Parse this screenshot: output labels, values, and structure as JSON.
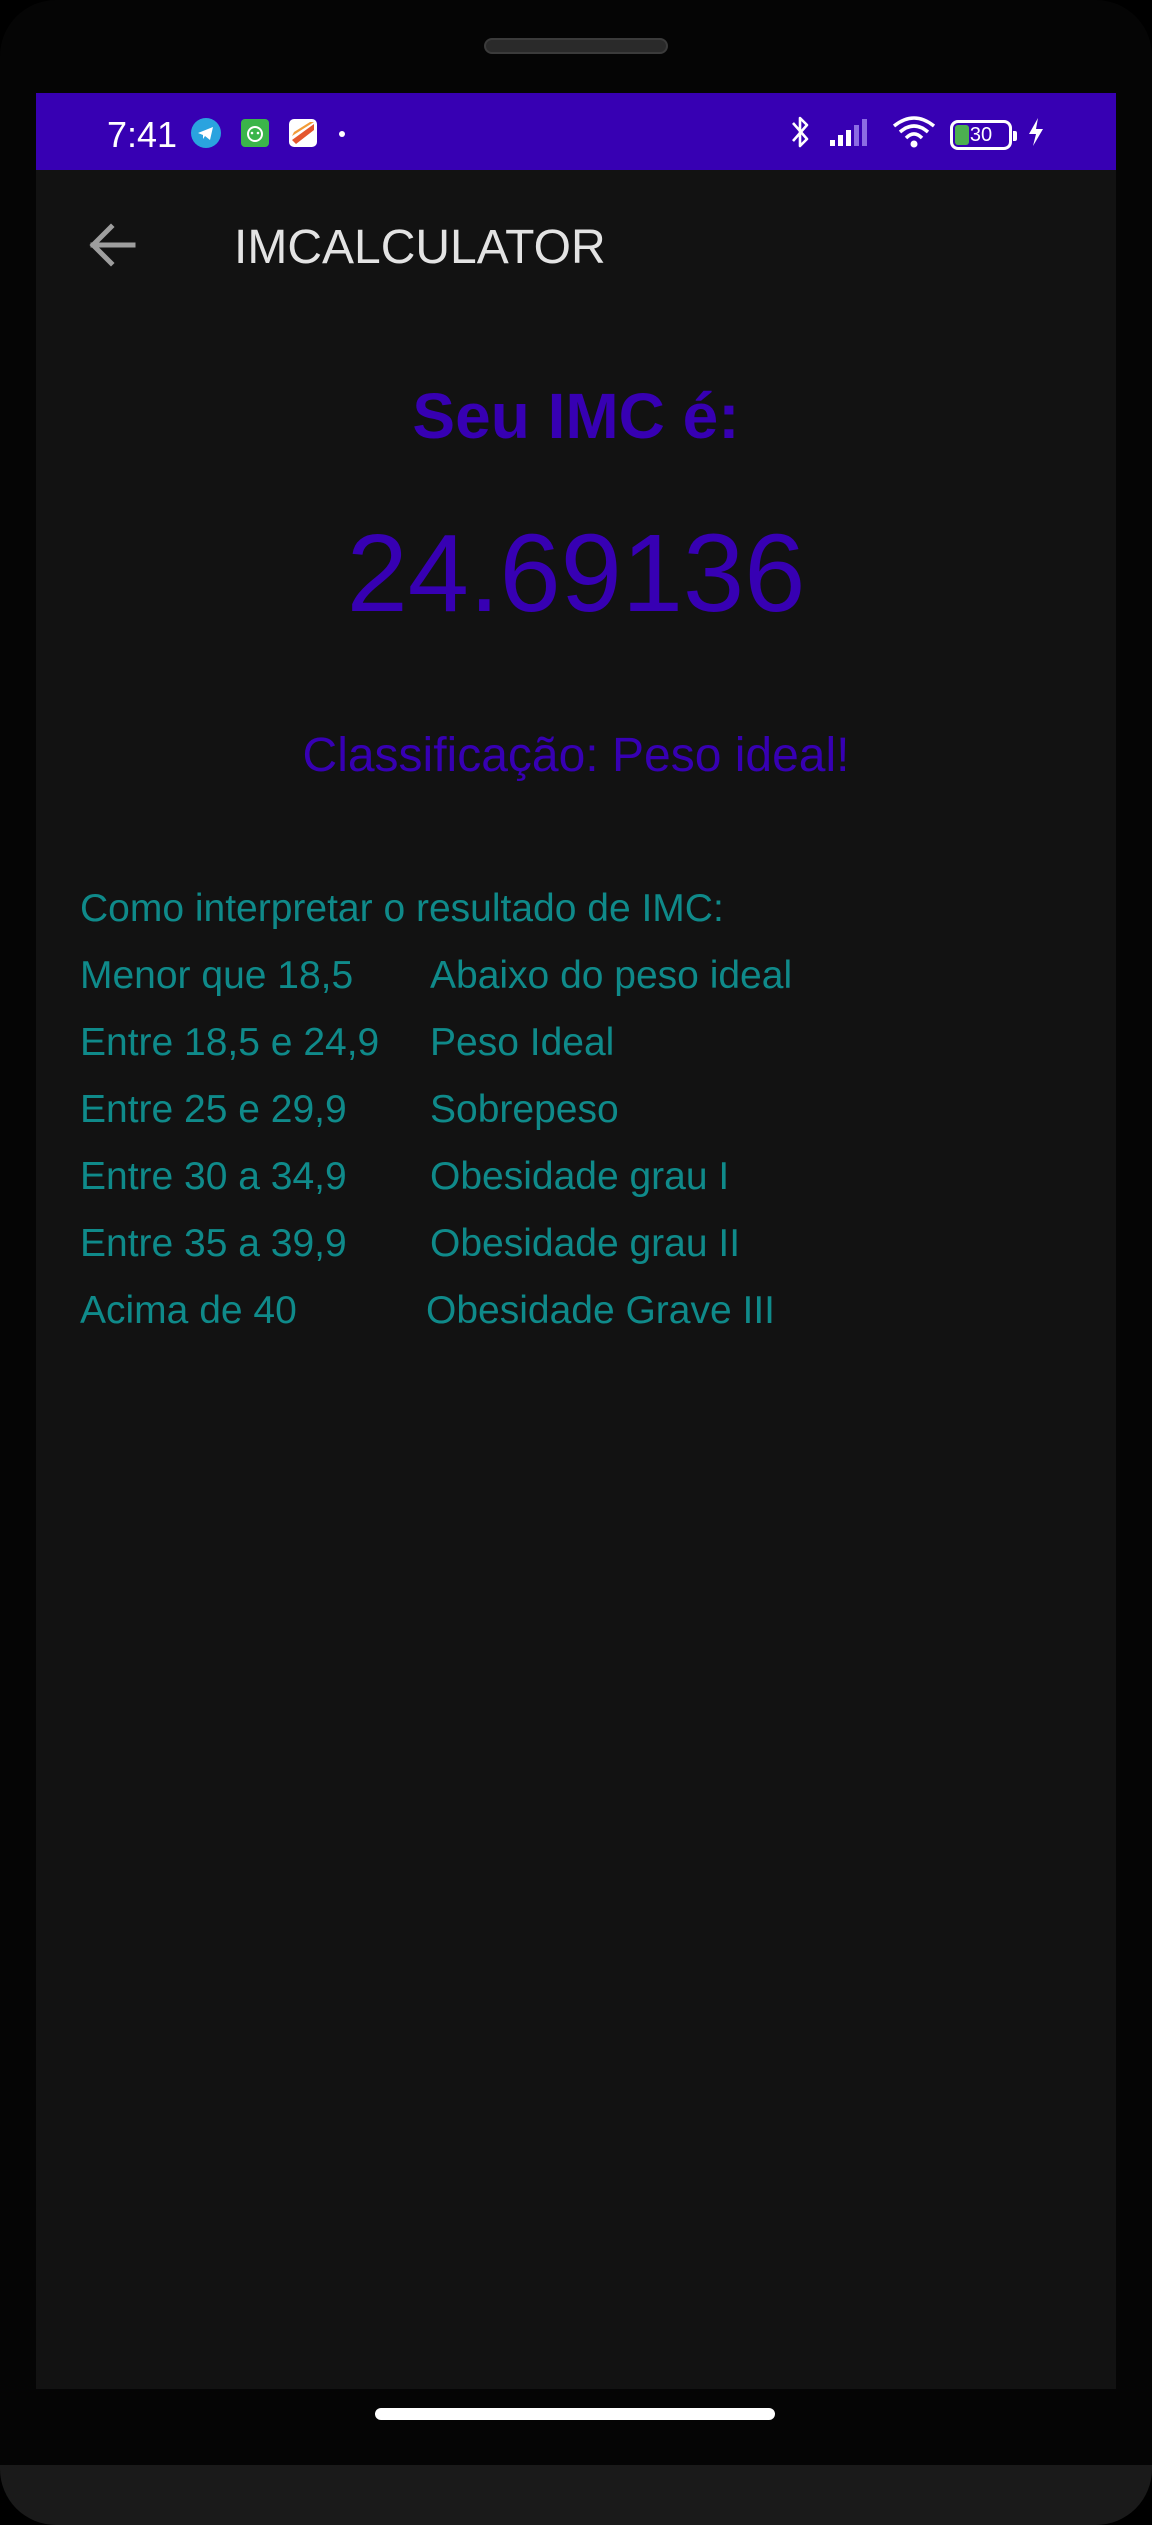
{
  "status_bar": {
    "time": "7:41",
    "left_icons": [
      "telegram-icon",
      "android-icon",
      "app-icon",
      "dot-icon"
    ],
    "right_icons": [
      "bluetooth-icon",
      "signal-icon",
      "wifi-icon",
      "battery-icon",
      "charging-icon"
    ],
    "battery_level": "30",
    "background_color": "#3700b3"
  },
  "app_bar": {
    "title": "IMCALCULATOR",
    "back_icon": "arrow-back-icon"
  },
  "result": {
    "heading": "Seu IMC é:",
    "value": "24.69136",
    "classification": "Classificação: Peso ideal!",
    "accent_color": "#3700b3"
  },
  "interpretation": {
    "title": "Como interpretar o resultado de IMC:",
    "rows": [
      {
        "range": "Menor que 18,5",
        "label": "Abaixo do peso ideal"
      },
      {
        "range": "Entre 18,5 e 24,9",
        "label": "Peso Ideal"
      },
      {
        "range": "Entre 25 e 29,9",
        "label": "Sobrepeso"
      },
      {
        "range": "Entre 30 a 34,9",
        "label": "Obesidade grau I"
      },
      {
        "range": "Entre 35 a 39,9",
        "label": "Obesidade grau II"
      },
      {
        "range": "Acima de 40",
        "label": "Obesidade Grave III"
      }
    ],
    "text_color": "#0f8a8a"
  }
}
